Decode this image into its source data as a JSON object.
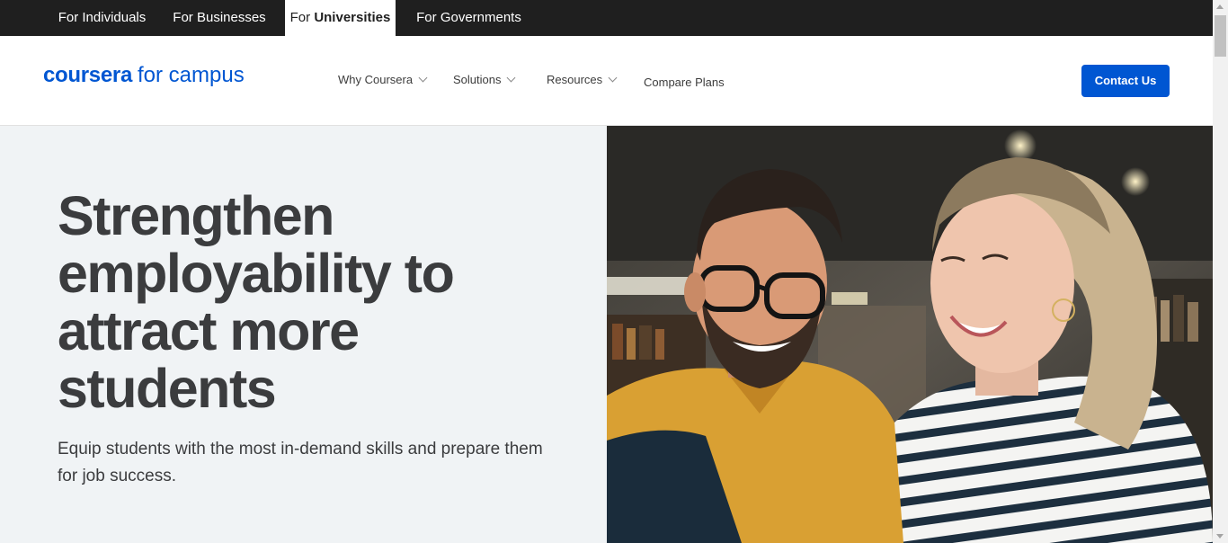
{
  "audience_tabs": [
    {
      "prefix": "For",
      "label": "Individuals",
      "active": false
    },
    {
      "prefix": "For",
      "label": "Businesses",
      "active": false
    },
    {
      "prefix": "For",
      "label": "Universities",
      "active": true
    },
    {
      "prefix": "For",
      "label": "Governments",
      "active": false
    }
  ],
  "logo": {
    "brand": "coursera",
    "sub": "for campus"
  },
  "nav": {
    "why": "Why Coursera",
    "solutions": "Solutions",
    "resources": "Resources",
    "compare": "Compare Plans"
  },
  "contact_button": "Contact Us",
  "hero": {
    "title": "Strengthen employability to attract more students",
    "description": "Equip students with the most in-demand skills and prepare them for job success."
  },
  "colors": {
    "brand": "#0056d2",
    "topbar": "#1f1f1f",
    "hero_bg": "#f0f3f5",
    "text": "#3b3c3e"
  },
  "image": {
    "subject": "hero-photo-two-students-smiling"
  }
}
